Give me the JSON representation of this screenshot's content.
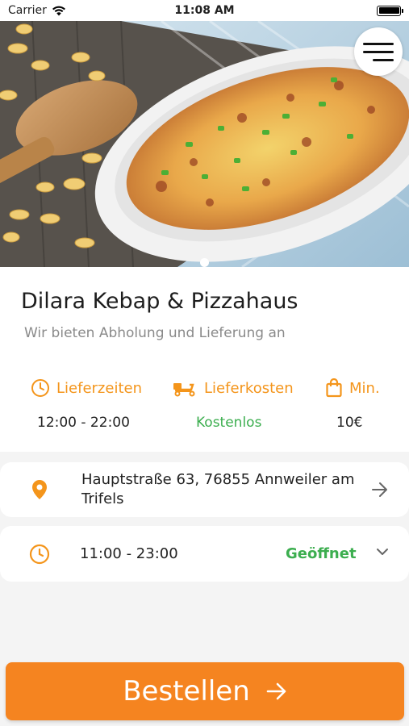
{
  "status_bar": {
    "carrier": "Carrier",
    "time": "11:08 AM"
  },
  "hero": {
    "image": "baked pasta casserole in white dish",
    "page_index": 1
  },
  "restaurant": {
    "name": "Dilara Kebap & Pizzahaus",
    "tagline": "Wir bieten Abholung und Lieferung an"
  },
  "stats": [
    {
      "label": "Lieferzeiten",
      "value": "12:00 - 22:00",
      "icon": "clock-icon"
    },
    {
      "label": "Lieferkosten",
      "value": "Kostenlos",
      "icon": "scooter-icon"
    },
    {
      "label": "Min.",
      "value": "10€",
      "icon": "bag-icon"
    }
  ],
  "address": {
    "line": "Hauptstraße 63, 76855 Annweiler am Trifels"
  },
  "hours": {
    "range": "11:00 - 23:00",
    "status": "Geöffnet"
  },
  "order_button": {
    "label": "Bestellen"
  },
  "colors": {
    "accent": "#f58420",
    "icon_orange": "#f4951b",
    "open_green": "#3cae4f"
  }
}
